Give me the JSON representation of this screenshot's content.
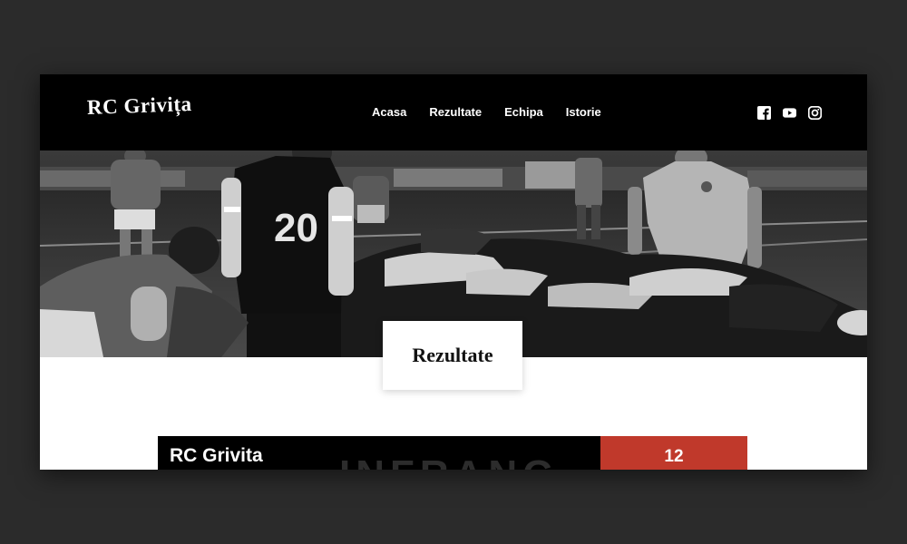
{
  "header": {
    "logo": "RC Grivița",
    "nav": [
      "Acasa",
      "Rezultate",
      "Echipa",
      "Istorie"
    ]
  },
  "social": {
    "icons": [
      "facebook-icon",
      "youtube-icon",
      "instagram-icon"
    ]
  },
  "hero": {
    "image": "rugby-scrum-photo",
    "jersey_number": "20",
    "title": "Rezultate"
  },
  "result": {
    "team": "RC Grivita",
    "score": "12",
    "watermark": "INFRANG"
  },
  "colors": {
    "header": "#000000",
    "accent": "#c0392b",
    "page_bg": "#2b2b2b"
  }
}
